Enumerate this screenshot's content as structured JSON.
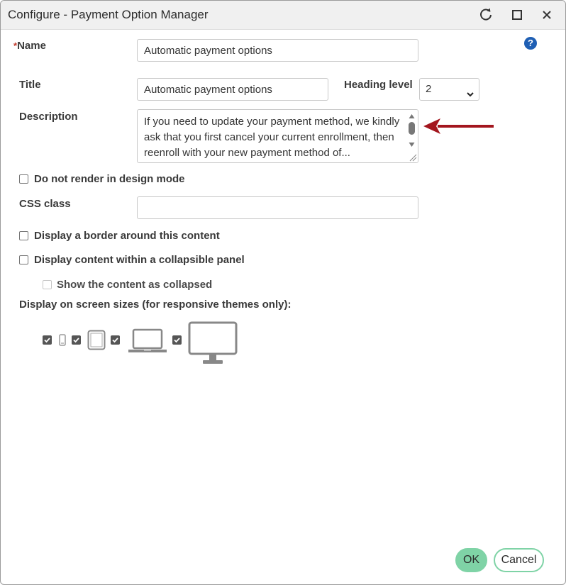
{
  "window": {
    "title": "Configure - Payment Option Manager",
    "refresh_icon": "refresh-icon",
    "maximize_icon": "maximize-icon",
    "close_icon": "close-icon"
  },
  "help": {
    "icon": "help-icon",
    "label": "?"
  },
  "fields": {
    "name": {
      "required_mark": "*",
      "label": "Name",
      "value": "Automatic payment options"
    },
    "title": {
      "label": "Title",
      "value": "Automatic payment options"
    },
    "heading_level": {
      "label": "Heading level",
      "value": "2"
    },
    "description": {
      "label": "Description",
      "value": "If you need to update your payment method, we kindly ask that you first cancel your current enrollment, then reenroll with your new payment method of..."
    },
    "css_class": {
      "label": "CSS class",
      "value": ""
    }
  },
  "options": {
    "do_not_render": {
      "label": "Do not render in design mode",
      "checked": false
    },
    "display_border": {
      "label": "Display a border around this content",
      "checked": false
    },
    "collapsible_panel": {
      "label": "Display content within a collapsible panel",
      "checked": false
    },
    "show_collapsed": {
      "label": "Show the content as collapsed",
      "checked": false,
      "disabled": true
    }
  },
  "screen_sizes": {
    "label": "Display on screen sizes (for responsive themes only):",
    "devices": [
      {
        "name": "phone",
        "icon": "phone-icon",
        "checked": true
      },
      {
        "name": "tablet",
        "icon": "tablet-icon",
        "checked": true
      },
      {
        "name": "laptop",
        "icon": "laptop-icon",
        "checked": true
      },
      {
        "name": "desktop",
        "icon": "desktop-icon",
        "checked": true
      }
    ]
  },
  "buttons": {
    "ok": "OK",
    "cancel": "Cancel"
  },
  "colors": {
    "accent": "#7fd3a6",
    "annotation_arrow": "#a3161e",
    "help": "#1f5fb4",
    "required": "#c0392b"
  }
}
